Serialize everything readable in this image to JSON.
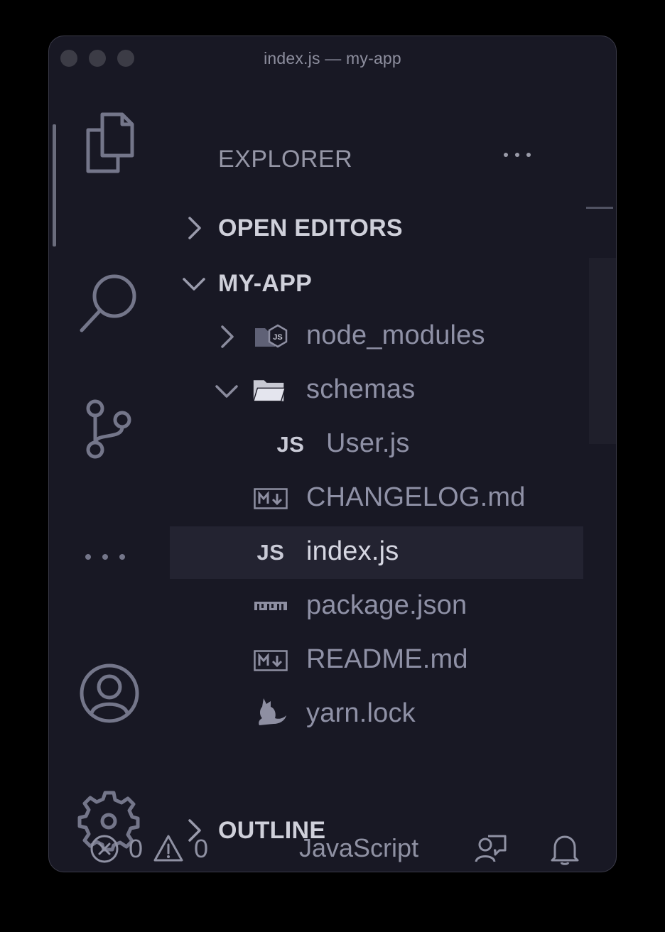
{
  "window": {
    "title": "index.js — my-app"
  },
  "activity_bar": {
    "items": [
      {
        "name": "explorer",
        "icon": "files-icon"
      },
      {
        "name": "search",
        "icon": "search-icon"
      },
      {
        "name": "source-control",
        "icon": "source-control-icon"
      },
      {
        "name": "more",
        "icon": "ellipsis-icon"
      },
      {
        "name": "accounts",
        "icon": "account-icon"
      },
      {
        "name": "manage",
        "icon": "gear-icon"
      }
    ]
  },
  "sidebar": {
    "title": "EXPLORER",
    "more_icon": "ellipsis-icon",
    "sections": {
      "open_editors": {
        "label": "OPEN EDITORS",
        "expanded": false
      },
      "project": {
        "label": "MY-APP",
        "expanded": true
      },
      "outline": {
        "label": "OUTLINE",
        "expanded": false
      }
    },
    "tree": [
      {
        "label": "node_modules",
        "type": "folder",
        "expanded": false,
        "icon": "node-folder-icon"
      },
      {
        "label": "schemas",
        "type": "folder",
        "expanded": true,
        "icon": "folder-open-icon"
      },
      {
        "label": "User.js",
        "type": "file",
        "icon": "js-file-icon",
        "icon_text": "JS"
      },
      {
        "label": "CHANGELOG.md",
        "type": "file",
        "icon": "markdown-file-icon"
      },
      {
        "label": "index.js",
        "type": "file",
        "icon": "js-file-icon",
        "icon_text": "JS",
        "selected": true
      },
      {
        "label": "package.json",
        "type": "file",
        "icon": "npm-file-icon"
      },
      {
        "label": "README.md",
        "type": "file",
        "icon": "markdown-file-icon"
      },
      {
        "label": "yarn.lock",
        "type": "file",
        "icon": "yarn-file-icon"
      }
    ]
  },
  "status_bar": {
    "errors": "0",
    "warnings": "0",
    "language": "JavaScript"
  },
  "colors": {
    "background": "#181824",
    "selection": "#232331",
    "text_dim": "#8f91a6",
    "text_bright": "#d6d7e2"
  }
}
